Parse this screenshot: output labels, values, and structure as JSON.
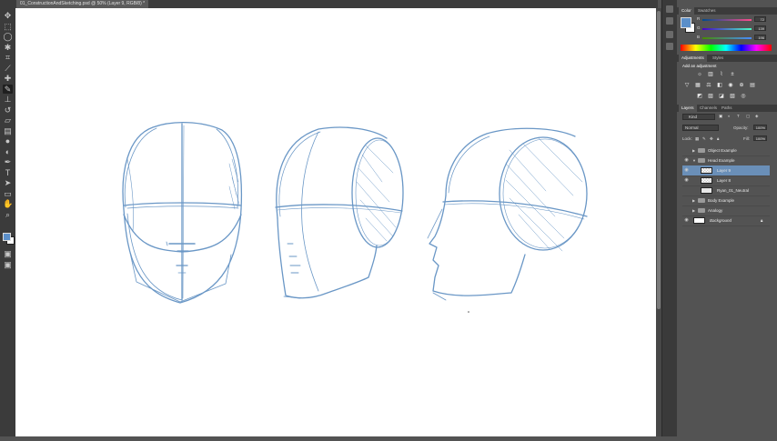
{
  "document": {
    "tab_title": "01_ConstructionAndSketching.psd @ 50% (Layer 9, RGB/8) *"
  },
  "colors": {
    "stroke": "#6a97c6",
    "fg_swatch": "#5b8fc9",
    "selection": "#6a8fb8"
  },
  "toolbar": {
    "tools": [
      "move-icon",
      "marquee-icon",
      "lasso-icon",
      "quick-select-icon",
      "crop-icon",
      "eyedropper-icon",
      "healing-icon",
      "brush-icon",
      "stamp-icon",
      "history-brush-icon",
      "eraser-icon",
      "gradient-icon",
      "blur-icon",
      "dodge-icon",
      "pen-icon",
      "type-icon",
      "path-select-icon",
      "shape-icon",
      "hand-icon",
      "zoom-icon"
    ]
  },
  "color_panel": {
    "tabs": [
      "Color",
      "Swatches"
    ],
    "channels": [
      {
        "label": "R",
        "value": "72"
      },
      {
        "label": "G",
        "value": "139"
      },
      {
        "label": "B",
        "value": "196"
      }
    ]
  },
  "adjustments_panel": {
    "tabs": [
      "Adjustments",
      "Styles"
    ],
    "heading": "Add an adjustment"
  },
  "layers_panel": {
    "tabs": [
      "Layers",
      "Channels",
      "Paths"
    ],
    "kind_label": "Kind",
    "blend_mode": "Normal",
    "opacity_label": "Opacity:",
    "opacity_value": "100%",
    "lock_label": "Lock:",
    "fill_label": "Fill:",
    "fill_value": "100%",
    "layers": [
      {
        "name": "Object Example",
        "kind": "group",
        "visible": false,
        "expanded": false
      },
      {
        "name": "Head Example",
        "kind": "group",
        "visible": true,
        "expanded": true
      },
      {
        "name": "Layer 9",
        "kind": "layer",
        "visible": true,
        "selected": true
      },
      {
        "name": "Layer 8",
        "kind": "layer",
        "visible": true
      },
      {
        "name": "Ryan_01_Neutral",
        "kind": "smart",
        "visible": false
      },
      {
        "name": "Body Example",
        "kind": "group",
        "visible": false,
        "expanded": false
      },
      {
        "name": "Analogy",
        "kind": "group",
        "visible": false,
        "expanded": false
      },
      {
        "name": "Background",
        "kind": "background",
        "visible": true,
        "locked": true
      }
    ]
  }
}
